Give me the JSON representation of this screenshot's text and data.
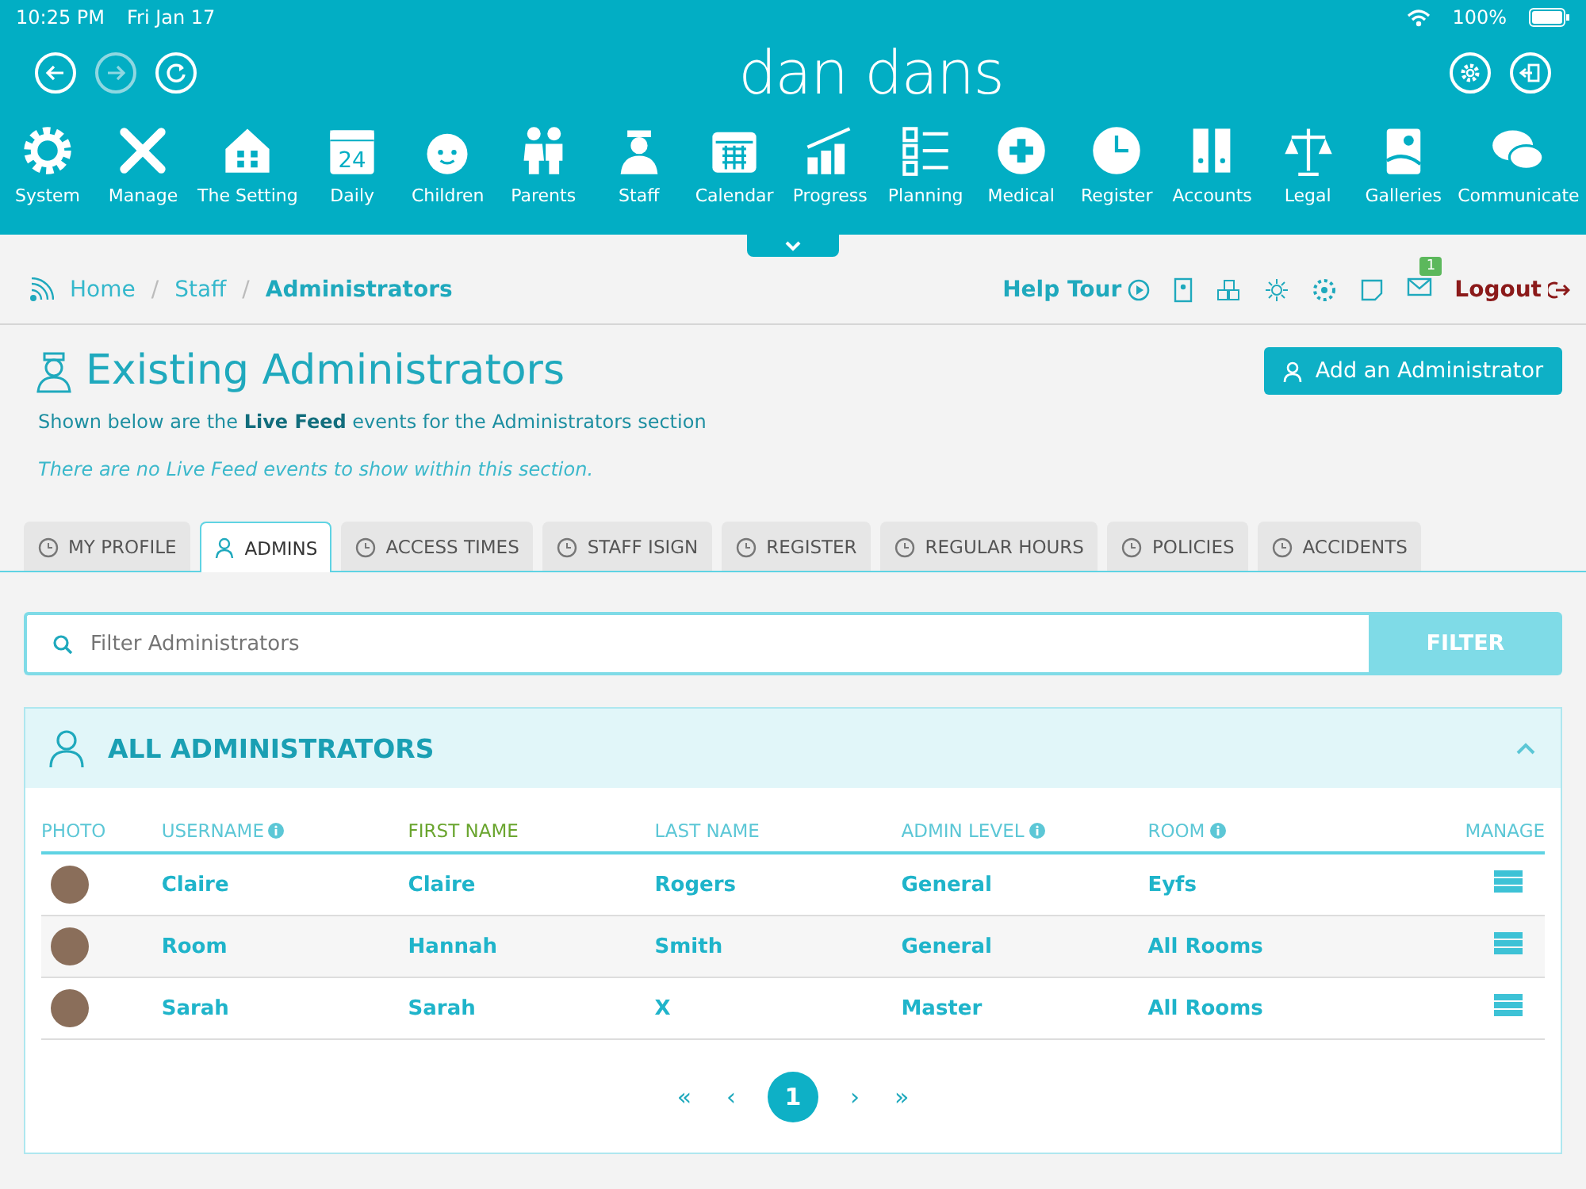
{
  "status_bar": {
    "time": "10:25 PM",
    "date": "Fri Jan 17",
    "battery": "100%"
  },
  "header": {
    "logo": "dan dans"
  },
  "nav": [
    {
      "label": "System"
    },
    {
      "label": "Manage"
    },
    {
      "label": "The Setting"
    },
    {
      "label": "Daily",
      "badge": "24"
    },
    {
      "label": "Children"
    },
    {
      "label": "Parents"
    },
    {
      "label": "Staff"
    },
    {
      "label": "Calendar"
    },
    {
      "label": "Progress"
    },
    {
      "label": "Planning"
    },
    {
      "label": "Medical"
    },
    {
      "label": "Register"
    },
    {
      "label": "Accounts"
    },
    {
      "label": "Legal"
    },
    {
      "label": "Galleries"
    },
    {
      "label": "Communicate"
    }
  ],
  "breadcrumb": {
    "items": [
      "Home",
      "Staff",
      "Administrators"
    ],
    "separators": [
      "/",
      "/"
    ]
  },
  "toolbar": {
    "help_tour": "Help Tour",
    "notification_count": "1",
    "logout": "Logout"
  },
  "page": {
    "title": "Existing Administrators",
    "add_button": "Add an Administrator",
    "intro": "Shown below are the **Live Feed** events for the Administrators section",
    "empty_note": "There are no Live Feed events to show within this section."
  },
  "tabs": [
    {
      "label": "MY PROFILE",
      "selected": false
    },
    {
      "label": "ADMINS",
      "selected": true
    },
    {
      "label": "ACCESS TIMES",
      "selected": false
    },
    {
      "label": "STAFF ISIGN",
      "selected": false
    },
    {
      "label": "REGISTER",
      "selected": false
    },
    {
      "label": "REGULAR HOURS",
      "selected": false
    },
    {
      "label": "POLICIES",
      "selected": false
    },
    {
      "label": "ACCIDENTS",
      "selected": false
    }
  ],
  "filter": {
    "placeholder": "Filter Administrators",
    "button": "FILTER"
  },
  "table": {
    "title": "ALL ADMINISTRATORS",
    "expanded": true,
    "columns": [
      {
        "label": "PHOTO",
        "info": false,
        "sorted": false
      },
      {
        "label": "USERNAME",
        "info": true,
        "sorted": false
      },
      {
        "label": "FIRST NAME",
        "info": false,
        "sorted": true
      },
      {
        "label": "LAST NAME",
        "info": false,
        "sorted": false
      },
      {
        "label": "ADMIN LEVEL",
        "info": true,
        "sorted": false
      },
      {
        "label": "ROOM",
        "info": true,
        "sorted": false
      },
      {
        "label": "MANAGE",
        "info": false,
        "sorted": false
      }
    ],
    "rows": [
      {
        "username": "Claire",
        "first_name": "Claire",
        "last_name": "Rogers",
        "admin_level": "General",
        "room": "Eyfs"
      },
      {
        "username": "Room",
        "first_name": "Hannah",
        "last_name": "Smith",
        "admin_level": "General",
        "room": "All Rooms"
      },
      {
        "username": "Sarah",
        "first_name": "Sarah",
        "last_name": "X",
        "admin_level": "Master",
        "room": "All Rooms"
      }
    ]
  },
  "pagination": {
    "first": "«",
    "prev": "‹",
    "pages": [
      {
        "label": "1",
        "selected": true
      }
    ],
    "next": "›",
    "last": "»"
  }
}
